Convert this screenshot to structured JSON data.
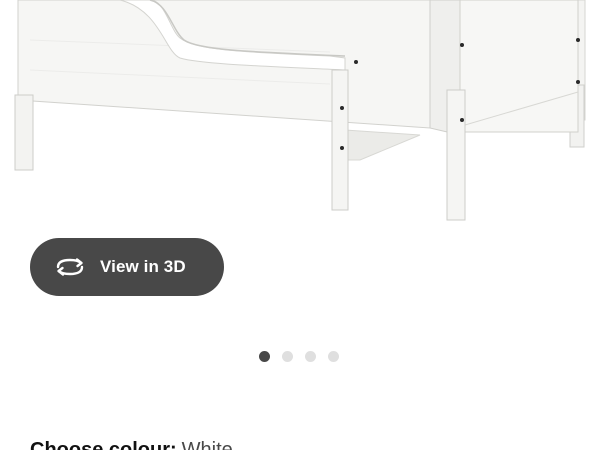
{
  "product": {
    "image_alt": "White extendable bed frame",
    "colors": {
      "frame": "#f6f6f4",
      "frame_shadow": "#e4e4e1",
      "outline": "#cfcfcb",
      "screws": "#2a2a2a"
    }
  },
  "view3d": {
    "label": "View in 3D",
    "icon": "rotate-3d-icon",
    "background": "#484848"
  },
  "carousel": {
    "total": 4,
    "active_index": 0
  },
  "colour": {
    "label": "Choose colour:",
    "value": "White"
  }
}
